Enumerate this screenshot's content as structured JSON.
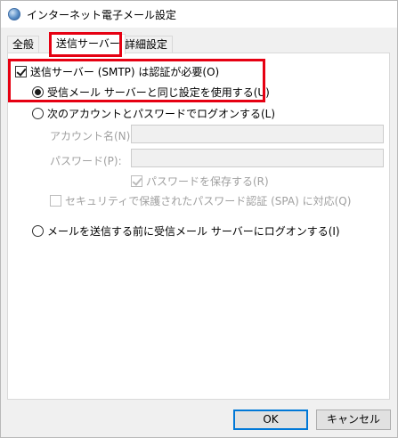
{
  "window": {
    "title": "インターネット電子メール設定",
    "icon": "globe-icon"
  },
  "tabs": [
    {
      "label": "全般",
      "active": false
    },
    {
      "label": "送信サーバー",
      "active": true
    },
    {
      "label": "詳細設定",
      "active": false
    }
  ],
  "outgoing": {
    "require_auth_label": "送信サーバー (SMTP) は認証が必要(O)",
    "require_auth_checked": true,
    "same_as_incoming_label": "受信メール サーバーと同じ設定を使用する(U)",
    "logon_using_label": "次のアカウントとパスワードでログオンする(L)",
    "account_name_label": "アカウント名(N):",
    "account_name_value": "",
    "password_label": "パスワード(P):",
    "password_value": "",
    "remember_password_label": "パスワードを保存する(R)",
    "remember_password_checked": true,
    "spa_label": "セキュリティで保護されたパスワード認証 (SPA) に対応(Q)",
    "spa_checked": false,
    "logon_before_send_label": "メールを送信する前に受信メール サーバーにログオンする(I)",
    "selected_option": "same_as_incoming"
  },
  "buttons": {
    "ok_label": "OK",
    "cancel_label": "キャンセル"
  },
  "colors": {
    "highlight": "#e60012",
    "default_button_border": "#0078d7"
  }
}
